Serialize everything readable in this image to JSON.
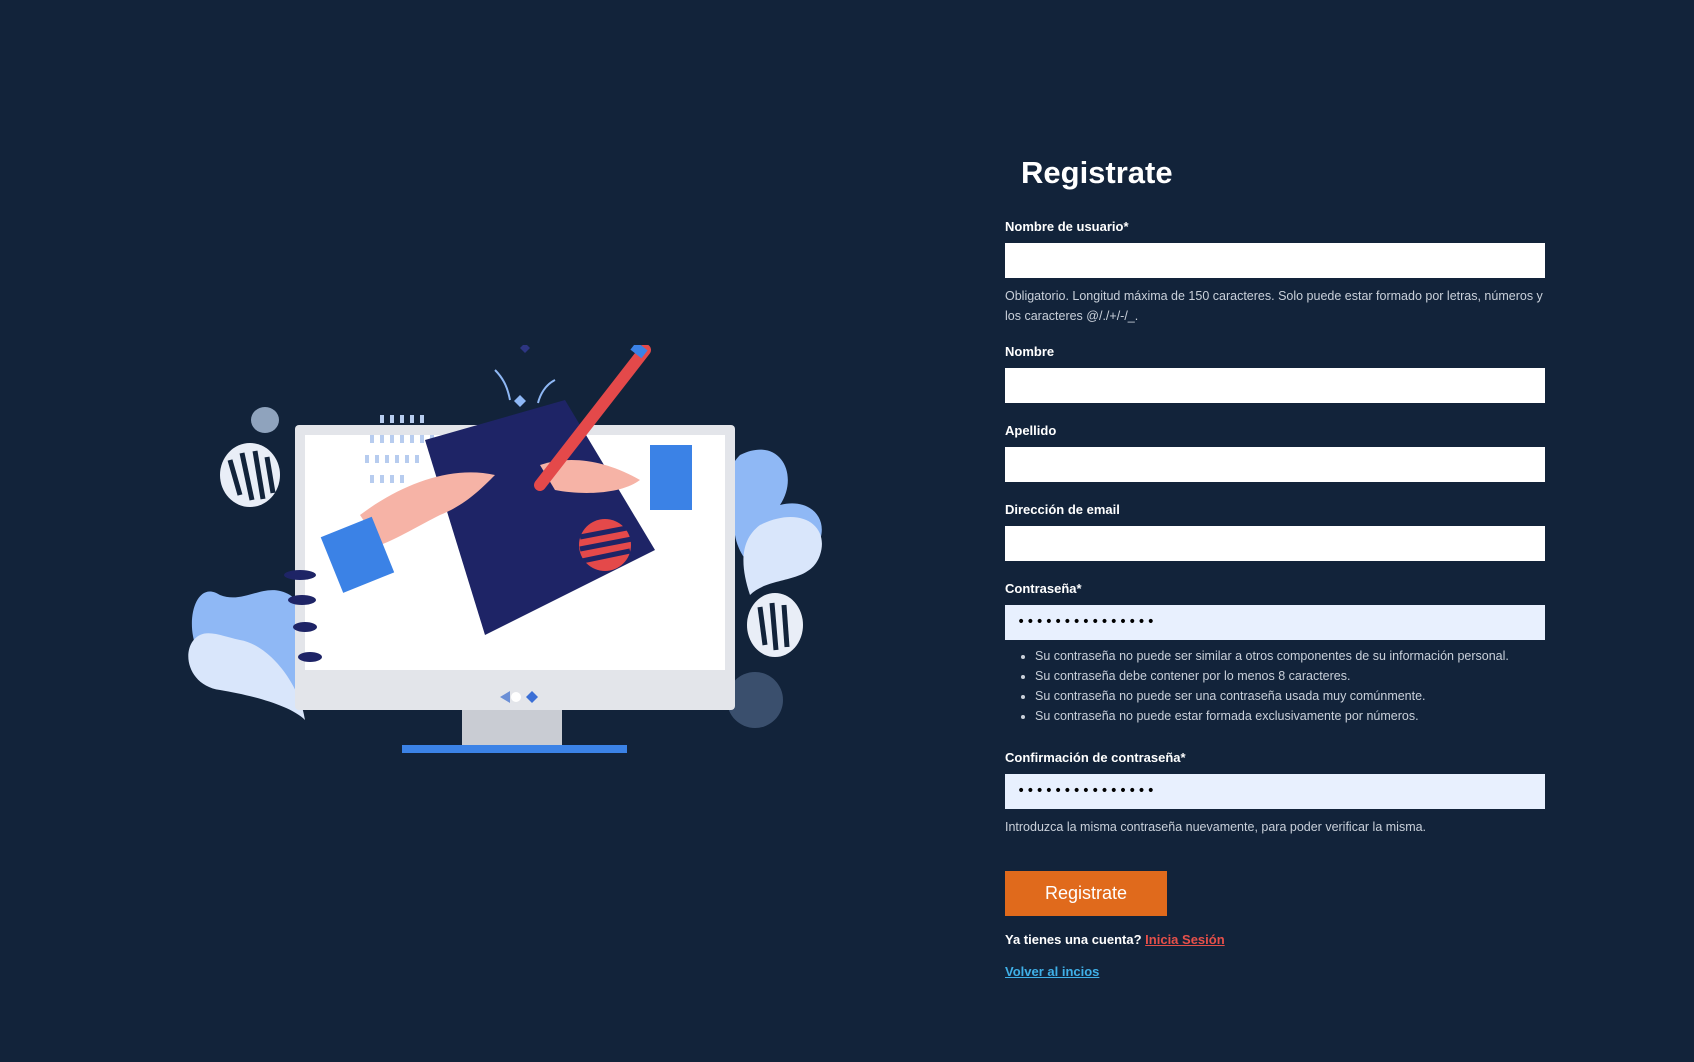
{
  "title": "Registrate",
  "fields": {
    "username": {
      "label": "Nombre de usuario*",
      "value": "",
      "help": "Obligatorio. Longitud máxima de 150 caracteres. Solo puede estar formado por letras, números y los caracteres @/./+/-/_."
    },
    "first_name": {
      "label": "Nombre",
      "value": ""
    },
    "last_name": {
      "label": "Apellido",
      "value": ""
    },
    "email": {
      "label": "Dirección de email",
      "value": ""
    },
    "password": {
      "label": "Contraseña*",
      "masked_value": "•••••••••••••••",
      "rules": [
        "Su contraseña no puede ser similar a otros componentes de su información personal.",
        "Su contraseña debe contener por lo menos 8 caracteres.",
        "Su contraseña no puede ser una contraseña usada muy comúnmente.",
        "Su contraseña no puede estar formada exclusivamente por números."
      ]
    },
    "password_confirm": {
      "label": "Confirmación de contraseña*",
      "masked_value": "•••••••••••••••",
      "help": "Introduzca la misma contraseña nuevamente, para poder verificar la misma."
    }
  },
  "submit_label": "Registrate",
  "login_prompt": "Ya tienes una cuenta?",
  "login_link": "Inicia Sesión",
  "back_link": "Volver al incios",
  "colors": {
    "background": "#12233a",
    "button": "#e06a1c",
    "login_link": "#e6504a",
    "back_link": "#3fb0e8",
    "autofill": "#e8f0fe"
  }
}
